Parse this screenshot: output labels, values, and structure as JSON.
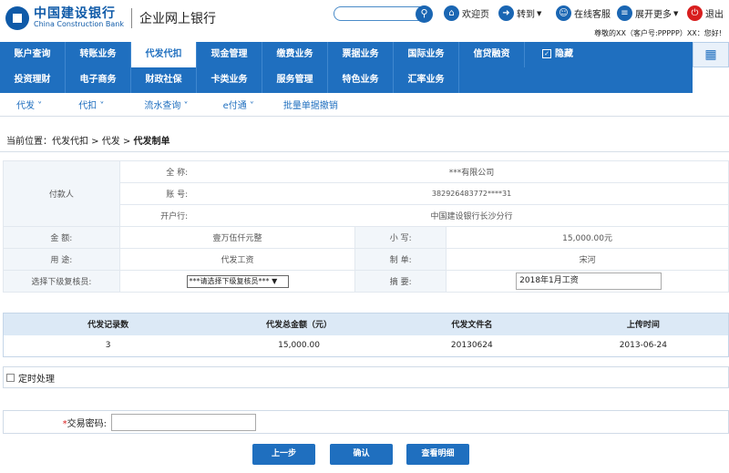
{
  "header": {
    "bank_name_cn": "中国建设银行",
    "bank_name_en": "China Construction Bank",
    "portal_title": "企业网上银行",
    "search_placeholder": "",
    "links": {
      "welcome": "欢迎页",
      "goto": "转到",
      "service": "在线客服",
      "expand": "展开更多",
      "logout": "退出"
    },
    "user_greeting": "尊敬的XX（客户号:PPPPP）XX：您好!"
  },
  "nav": {
    "row1": [
      "账户查询",
      "转账业务",
      "代发代扣",
      "现金管理",
      "缴费业务",
      "票据业务",
      "国际业务",
      "信贷融资"
    ],
    "hide": "隐藏",
    "row2": [
      "投资理财",
      "电子商务",
      "财政社保",
      "卡类业务",
      "服务管理",
      "特色业务",
      "汇率业务"
    ]
  },
  "subnav": [
    "代发",
    "代扣",
    "流水查询",
    "e付通",
    "批量单据撤销"
  ],
  "breadcrumb": {
    "prefix": "当前位置：代发代扣 > 代发 > ",
    "current": "代发制单"
  },
  "payer": {
    "section": "付款人",
    "fullname_label": "全  称:",
    "fullname": "***有限公司",
    "account_label": "账  号:",
    "account": "382926483772****31",
    "bank_label": "开户行:",
    "bank": "中国建设银行长沙分行"
  },
  "details": {
    "amount_label": "金   额:",
    "amount_words": "壹万伍仟元整",
    "small_label": "小   写:",
    "amount_num": "15,000.00元",
    "purpose_label": "用   途:",
    "purpose": "代发工资",
    "maker_label": "制   单:",
    "maker": "宋河",
    "reviewer_label": "选择下级复核员:",
    "reviewer_select": "***请选择下级复核员***",
    "memo_label": "摘   要:",
    "memo": "2018年1月工资"
  },
  "file_table": {
    "headers": [
      "代发记录数",
      "代发总金额（元）",
      "代发文件名",
      "上传时间"
    ],
    "rows": [
      [
        "3",
        "15,000.00",
        "20130624",
        "2013-06-24"
      ]
    ]
  },
  "timed_label": "定时处理",
  "password_label": "交易密码:",
  "buttons": {
    "prev": "上一步",
    "confirm": "确认",
    "view": "查看明细"
  }
}
